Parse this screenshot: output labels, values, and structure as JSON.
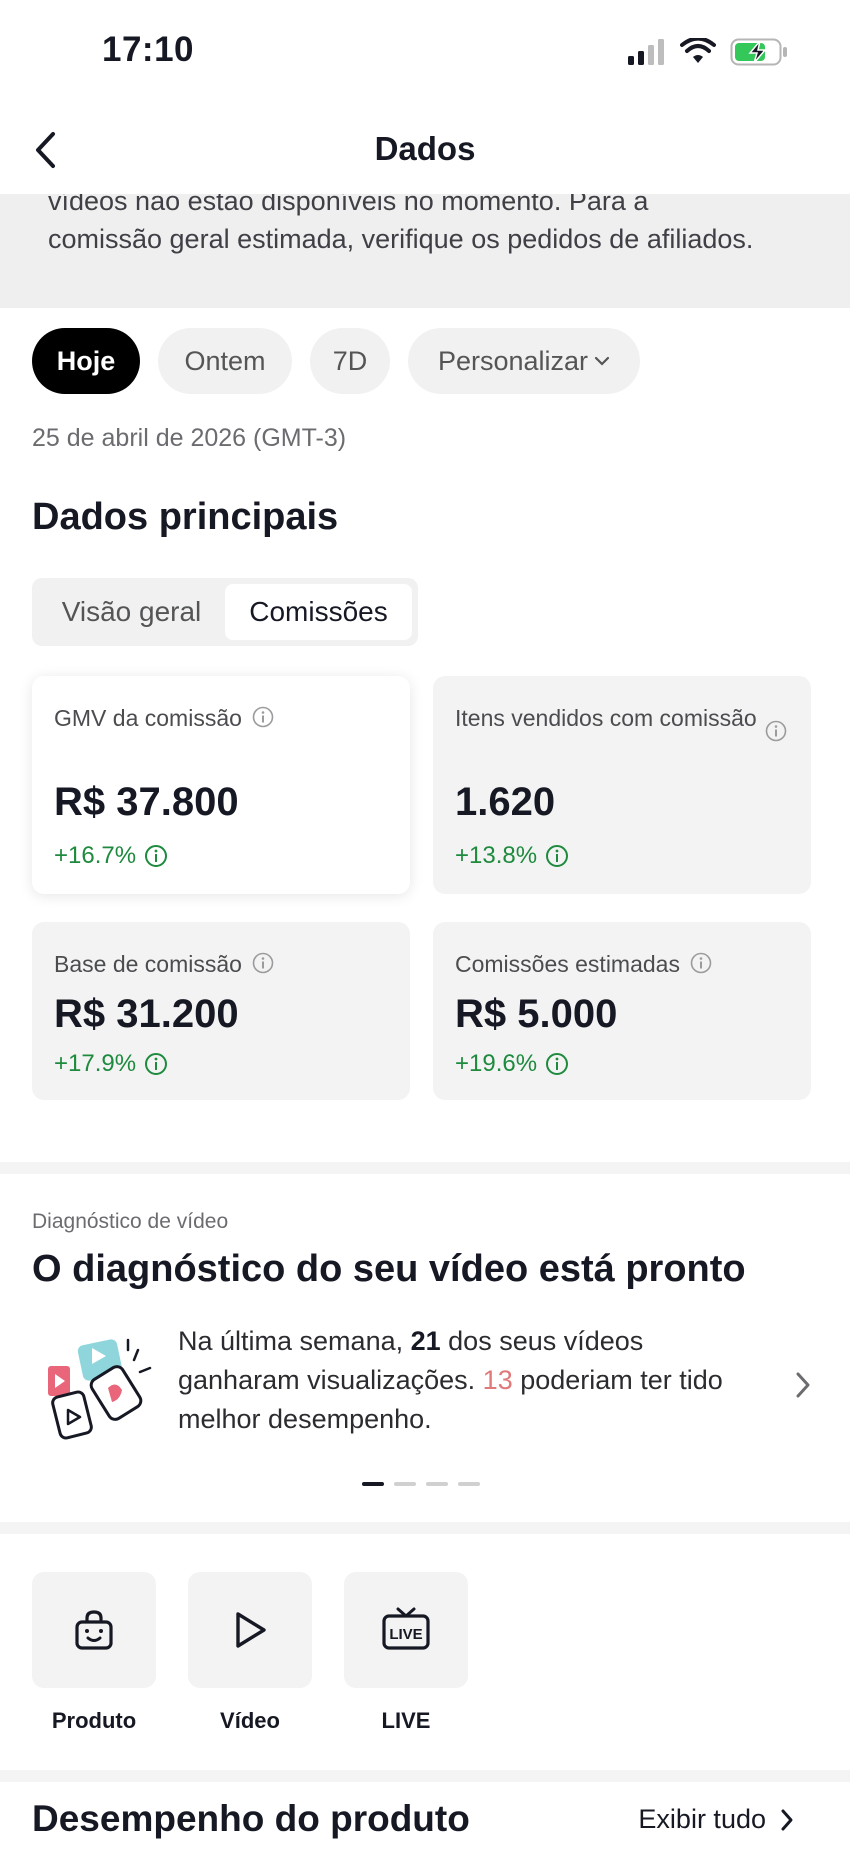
{
  "status_bar": {
    "time": "17:10"
  },
  "nav": {
    "title": "Dados"
  },
  "banner": {
    "text": "vídeos não estão disponíveis no momento. Para a comissão geral estimada, verifique os pedidos de afiliados."
  },
  "filters": [
    {
      "label": "Hoje",
      "active": true
    },
    {
      "label": "Ontem",
      "active": false
    },
    {
      "label": "7D",
      "active": false
    },
    {
      "label": "Personalizar",
      "active": false
    }
  ],
  "date_text": "25 de abril de 2026 (GMT-3)",
  "main_data": {
    "title": "Dados principais",
    "tabs": [
      {
        "label": "Visão geral",
        "active": false
      },
      {
        "label": "Comissões",
        "active": true
      }
    ],
    "metrics": [
      {
        "label": "GMV da comissão",
        "value": "R$ 37.800",
        "delta": "+16.7%"
      },
      {
        "label": "Itens vendidos com comissão",
        "value": "1.620",
        "delta": "+13.8%"
      },
      {
        "label": "Base de comissão",
        "value": "R$ 31.200",
        "delta": "+17.9%"
      },
      {
        "label": "Comissões estimadas",
        "value": "R$ 5.000",
        "delta": "+19.6%"
      }
    ]
  },
  "diagnostic": {
    "kicker": "Diagnóstico de vídeo",
    "title": "O diagnóstico do seu vídeo está pronto",
    "text_1": "Na última semana, ",
    "count_gained": "21",
    "text_2": " dos seus vídeos ganharam visualizações. ",
    "count_better": "13",
    "text_3": " poderiam ter tido melhor desempenho.",
    "page_count": 4,
    "active_page": 1
  },
  "shortcuts": [
    {
      "label": "Produto",
      "icon": "shopping-bag-icon"
    },
    {
      "label": "Vídeo",
      "icon": "play-icon"
    },
    {
      "label": "LIVE",
      "icon": "live-icon"
    }
  ],
  "product_performance": {
    "title": "Desempenho do produto",
    "link": "Exibir tudo"
  },
  "colors": {
    "positive": "#1e8a3e",
    "highlight_red": "#e07a7a",
    "chip_active": "#000000"
  }
}
